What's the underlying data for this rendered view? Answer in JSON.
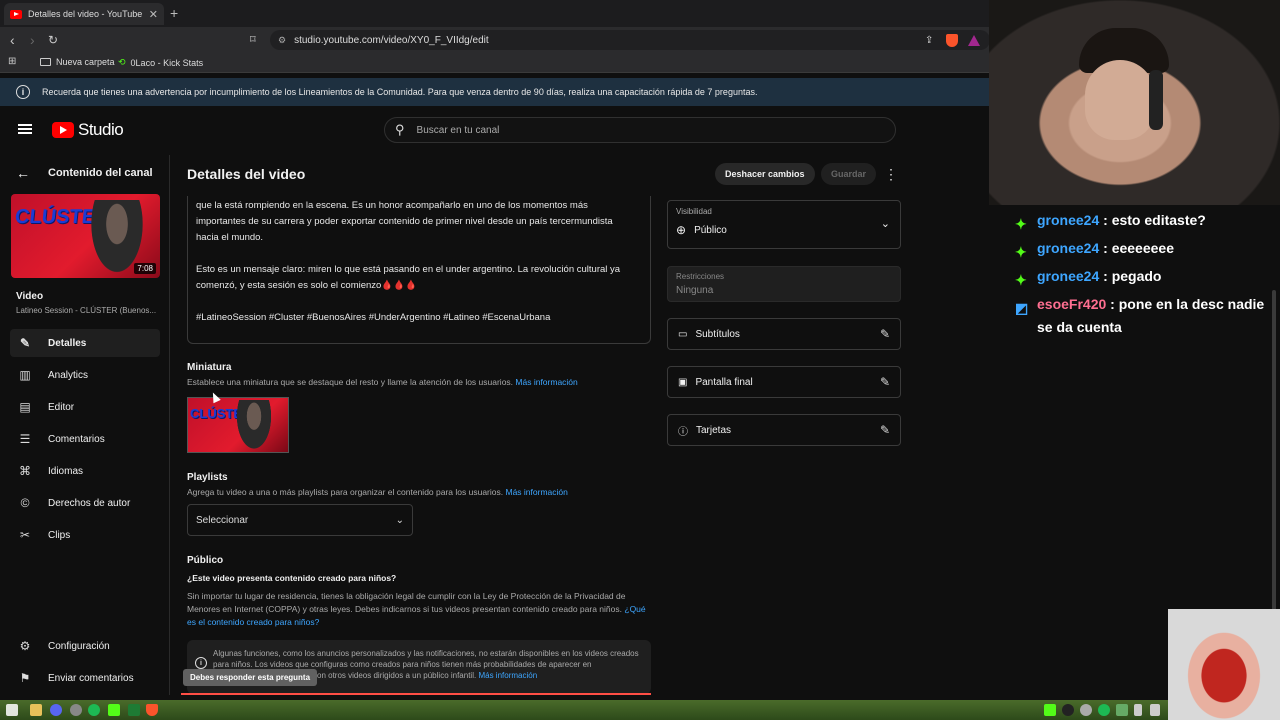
{
  "browser": {
    "tab_title": "Detalles del video - YouTube Stu",
    "url": "studio.youtube.com/video/XY0_F_VIIdg/edit",
    "bookmarks": [
      "Nueva carpeta",
      "0Laco - Kick Stats"
    ]
  },
  "banner": {
    "text": "Recuerda que tienes una advertencia por incumplimiento de los Lineamientos de la Comunidad. Para que venza dentro de 90 días, realiza una capacitación rápida de 7 preguntas."
  },
  "header": {
    "logo_text": "Studio",
    "search_placeholder": "Buscar en tu canal"
  },
  "sidebar": {
    "back_label": "Contenido del canal",
    "thumb_title": "CLÚSTER",
    "thumb_duration": "7:08",
    "video_label": "Video",
    "video_title": "Latineo Session - CLÚSTER (Buenos...",
    "items": [
      {
        "label": "Detalles",
        "icon": "pencil-icon"
      },
      {
        "label": "Analytics",
        "icon": "analytics-icon"
      },
      {
        "label": "Editor",
        "icon": "editor-icon"
      },
      {
        "label": "Comentarios",
        "icon": "comments-icon"
      },
      {
        "label": "Idiomas",
        "icon": "languages-icon"
      },
      {
        "label": "Derechos de autor",
        "icon": "copyright-icon"
      },
      {
        "label": "Clips",
        "icon": "scissors-icon"
      }
    ],
    "settings_label": "Configuración",
    "feedback_label": "Enviar comentarios"
  },
  "main": {
    "title": "Detalles del video",
    "undo_label": "Deshacer cambios",
    "save_label": "Guardar",
    "description": "que la está rompiendo en la escena. Es un honor acompañarlo en uno de los momentos más\nimportantes de su carrera y poder exportar contenido de primer nivel desde un país tercermundista\nhacia el mundo.\n\nEsto es un mensaje claro: miren lo que está pasando en el under argentino. La revolución cultural ya\ncomenzó, y esta sesión es solo el comienzo🩸🩸🩸\n\n#LatineoSession #Cluster #BuenosAires #UnderArgentino #Latineo #EscenaUrbana",
    "thumbnail": {
      "heading": "Miniatura",
      "sub": "Establece una miniatura que se destaque del resto y llame la atención de los usuarios.",
      "link": "Más información"
    },
    "playlists": {
      "heading": "Playlists",
      "sub": "Agrega tu video a una o más playlists para organizar el contenido para los usuarios.",
      "link": "Más información",
      "select_value": "Seleccionar"
    },
    "audience": {
      "heading": "Público",
      "question": "¿Este video presenta contenido creado para niños?",
      "body": "Sin importar tu lugar de residencia, tienes la obligación legal de cumplir con la Ley de Protección de la Privacidad de Menores en Internet (COPPA) y otras leyes. Debes indicarnos si tus videos presentan contenido creado para niños.",
      "link": "¿Qué es el contenido creado para niños?",
      "notice": "Algunas funciones, como los anuncios personalizados y las notificaciones, no estarán disponibles en los videos creados para niños. Los videos que configuras como creados para niños tienen más probabilidades de aparecer en",
      "notice_tail": "con otros videos dirigidos a un público infantil.",
      "notice_link": "Más información",
      "tooltip": "Debes responder esta pregunta"
    }
  },
  "right": {
    "visibility_label": "Visibilidad",
    "visibility_value": "Público",
    "restrictions_label": "Restricciones",
    "restrictions_value": "Ninguna",
    "subtitles_label": "Subtítulos",
    "endscreen_label": "Pantalla final",
    "cards_label": "Tarjetas"
  },
  "chat": [
    {
      "user": "gronee24",
      "msg": ": esto editaste?",
      "color": "#3ea6ff"
    },
    {
      "user": "gronee24",
      "msg": ": eeeeeeee",
      "color": "#3ea6ff"
    },
    {
      "user": "gronee24",
      "msg": ": pegado",
      "color": "#3ea6ff"
    },
    {
      "user": "esoeFr420",
      "msg": ": pone en la desc nadie se da cuenta",
      "color": "#ff6f91"
    }
  ],
  "colors": {
    "accent_link": "#3ea6ff",
    "brand_red": "#ff0000",
    "error": "#ff4e45"
  }
}
